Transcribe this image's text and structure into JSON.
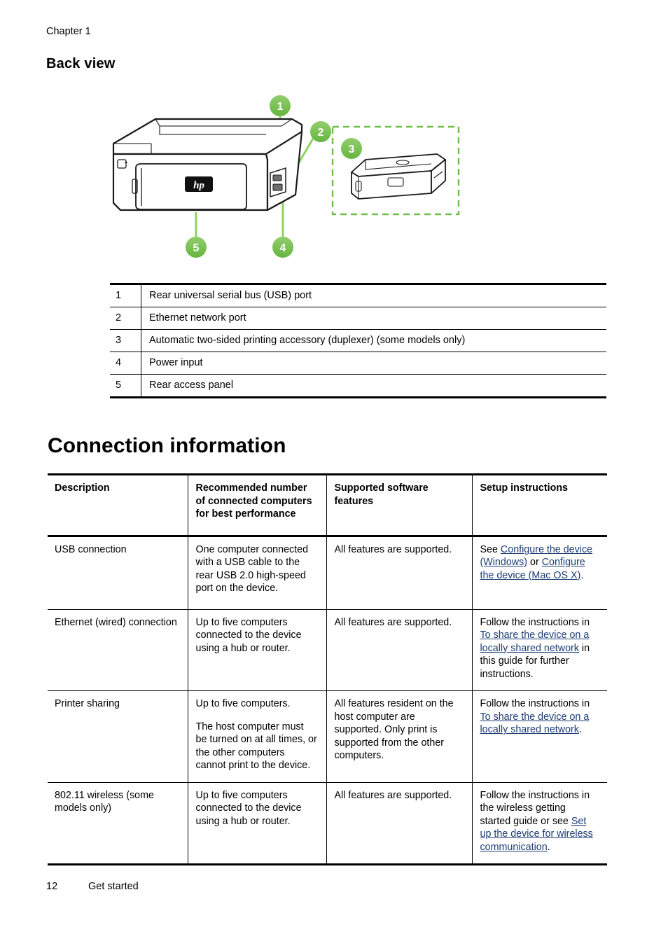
{
  "header": {
    "chapter": "Chapter 1"
  },
  "section": {
    "heading": "Back view"
  },
  "figure": {
    "alt": "Back view of the printer with numbered callouts",
    "callouts": [
      {
        "n": "1",
        "target": "rear USB port"
      },
      {
        "n": "2",
        "target": "ethernet network port"
      },
      {
        "n": "3",
        "target": "duplexer accessory"
      },
      {
        "n": "4",
        "target": "power input"
      },
      {
        "n": "5",
        "target": "rear access panel"
      }
    ],
    "logo_text": "hp",
    "colors": {
      "callout_green": "#6fbe4a",
      "callout_green_light": "#8dcc6a",
      "leader_green": "#8dd35f",
      "dashed_green": "#6fbe4a",
      "outline": "#1a1a1a"
    }
  },
  "legend_table": {
    "rows": [
      {
        "num": "1",
        "desc": "Rear universal serial bus (USB) port"
      },
      {
        "num": "2",
        "desc": "Ethernet network port"
      },
      {
        "num": "3",
        "desc": "Automatic two-sided printing accessory (duplexer) (some models only)"
      },
      {
        "num": "4",
        "desc": "Power input"
      },
      {
        "num": "5",
        "desc": "Rear access panel"
      }
    ]
  },
  "page_title": "Connection information",
  "conn_table": {
    "headers": [
      "Description",
      "Recommended number of connected computers for best performance",
      "Supported software features",
      "Setup instructions"
    ],
    "rows": [
      {
        "description": "USB connection",
        "recommended": "One computer connected with a USB cable to the rear USB 2.0 high-speed port on the device.",
        "features": "All features are supported.",
        "setup": {
          "pre": "See ",
          "link1": "Configure the device (Windows)",
          "mid": " or ",
          "link2": "Configure the device (Mac OS X)",
          "post": "."
        }
      },
      {
        "description": "Ethernet (wired) connection",
        "recommended": "Up to five computers connected to the device using a hub or router.",
        "features": "All features are supported.",
        "setup": {
          "pre": "Follow the instructions in ",
          "link1": "To share the device on a locally shared network",
          "mid": " in this guide for further instructions.",
          "link2": "",
          "post": ""
        }
      },
      {
        "description": "Printer sharing",
        "recommended_p1": "Up to five computers.",
        "recommended_p2": "The host computer must be turned on at all times, or the other computers cannot print to the device.",
        "features": "All features resident on the host computer are supported. Only print is supported from the other computers.",
        "setup": {
          "pre": "Follow the instructions in ",
          "link1": "To share the device on a locally shared network",
          "mid": "",
          "link2": "",
          "post": "."
        }
      },
      {
        "description": "802.11 wireless (some models only)",
        "recommended": "Up to five computers connected to the device using a hub or router.",
        "features": "All features are supported.",
        "setup": {
          "pre": "Follow the instructions in the wireless getting started guide or see ",
          "link1": "Set up the device for wireless communication",
          "mid": "",
          "link2": "",
          "post": "."
        }
      }
    ]
  },
  "footer": {
    "page_number": "12",
    "section_name": "Get started"
  }
}
